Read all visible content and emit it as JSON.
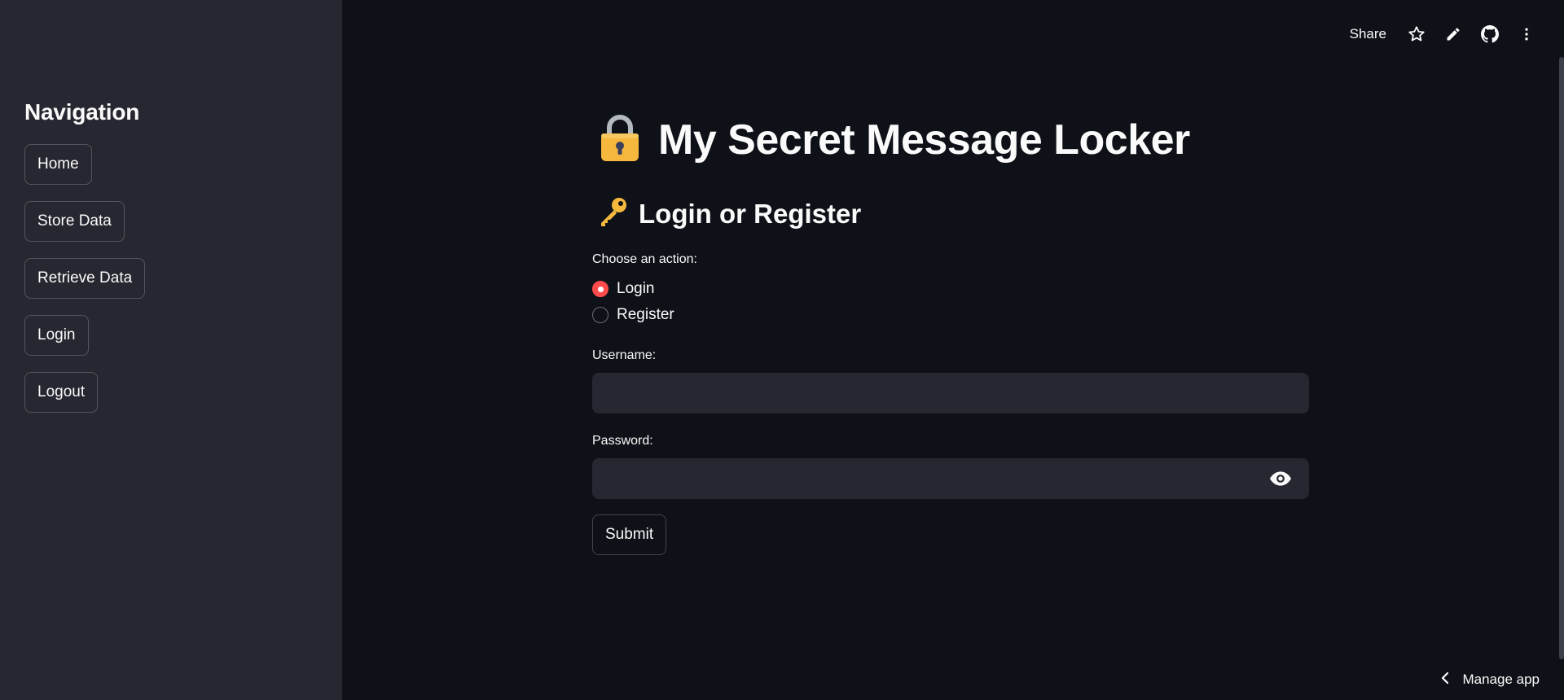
{
  "sidebar": {
    "title": "Navigation",
    "items": [
      {
        "label": "Home"
      },
      {
        "label": "Store Data"
      },
      {
        "label": "Retrieve Data"
      },
      {
        "label": "Login"
      },
      {
        "label": "Logout"
      }
    ]
  },
  "toolbar": {
    "share_label": "Share",
    "icons": [
      "star-icon",
      "pencil-icon",
      "github-icon",
      "more-vert-icon"
    ]
  },
  "main": {
    "title": "My Secret Message Locker",
    "title_icon": "lock-icon",
    "subheader": "Login or Register",
    "subheader_icon": "key-icon",
    "action_label": "Choose an action:",
    "radio_options": [
      {
        "label": "Login",
        "selected": true
      },
      {
        "label": "Register",
        "selected": false
      }
    ],
    "username_label": "Username:",
    "username_value": "",
    "password_label": "Password:",
    "password_value": "",
    "submit_label": "Submit"
  },
  "footer": {
    "manage_label": "Manage app"
  },
  "colors": {
    "background": "#0e1117",
    "sidebar": "#262730",
    "input_bg": "#262730",
    "accent": "#ff4b4b",
    "text": "#fafafa"
  }
}
